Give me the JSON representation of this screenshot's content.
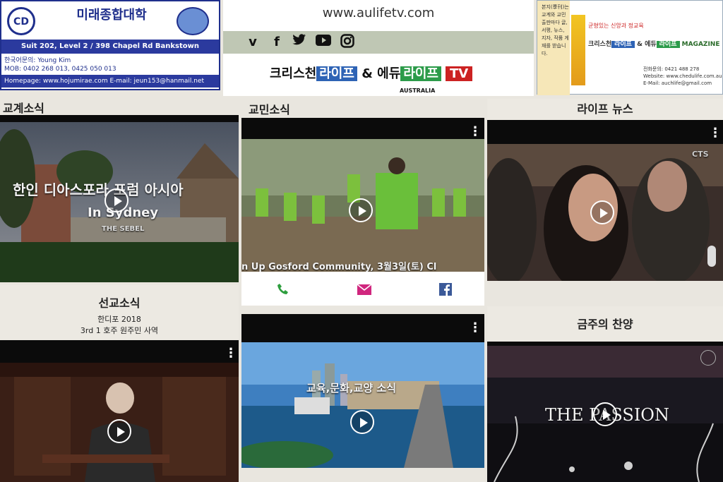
{
  "ads": {
    "left": {
      "logo": "CD",
      "name": "미래종합대학",
      "address": "Suit 202, Level 2 / 398 Chapel Rd Bankstown",
      "contact_label": "한국어문의:",
      "contact_name": "Young Kim",
      "contact_mob": "MOB: 0402 268 013, 0425 050 013",
      "homepage": "Homepage: www.hojumirae.com  E-mail: jeun153@hanmail.net"
    },
    "middle": {
      "url": "www.aulifetv.com",
      "title_prefix": "크리스천",
      "title_life1": "라이프",
      "title_mid": "& 에듀",
      "title_life2": "라이프",
      "title_tv": "TV",
      "subtitle": "AUSTRALIA"
    },
    "right": {
      "small_text": "본지(季刊)는 교계와 교민출판마다 글, 서평, 뉴스, 지자, 작품 게재를 받습니다.",
      "slogan": "균형있는 신앙과 정교육",
      "mag_prefix": "크리스천",
      "mag_life1": "라이프",
      "mag_mid": "& 에듀",
      "mag_life2": "라이프",
      "mag_suffix": "MAGAZINE",
      "contact_phone": "전화문의: 0421 488 278",
      "contact_web": "Website: www.chedulife.com.au",
      "contact_email": "E-Mail: auchlife@gmail.com"
    }
  },
  "sections": [
    {
      "title": "교계소식",
      "overlay": "한인 디아스포라 포럼 아시아",
      "overlay2": "In Sydney",
      "sign": "THE SEBEL"
    },
    {
      "title": "교민소식",
      "caption": "n Up Gosford Community, 3월3일(토) Cl"
    },
    {
      "title": "라이프 뉴스",
      "watermark": "CTS"
    },
    {
      "title": "선교소식",
      "sub1": "한디포 2018",
      "sub2": "3rd 1 호주 원주민 사역"
    },
    {
      "title": "",
      "overlay": "교육,문화,교양 소식"
    },
    {
      "title": "금주의 찬양",
      "overlay": "THE PASSION"
    }
  ],
  "share_icons": [
    "phone-icon",
    "mail-icon",
    "facebook-icon"
  ],
  "colors": {
    "phone": "#2e9e3e",
    "mail": "#d0267e",
    "facebook": "#3b5998",
    "brand_blue": "#1f2f8c"
  }
}
